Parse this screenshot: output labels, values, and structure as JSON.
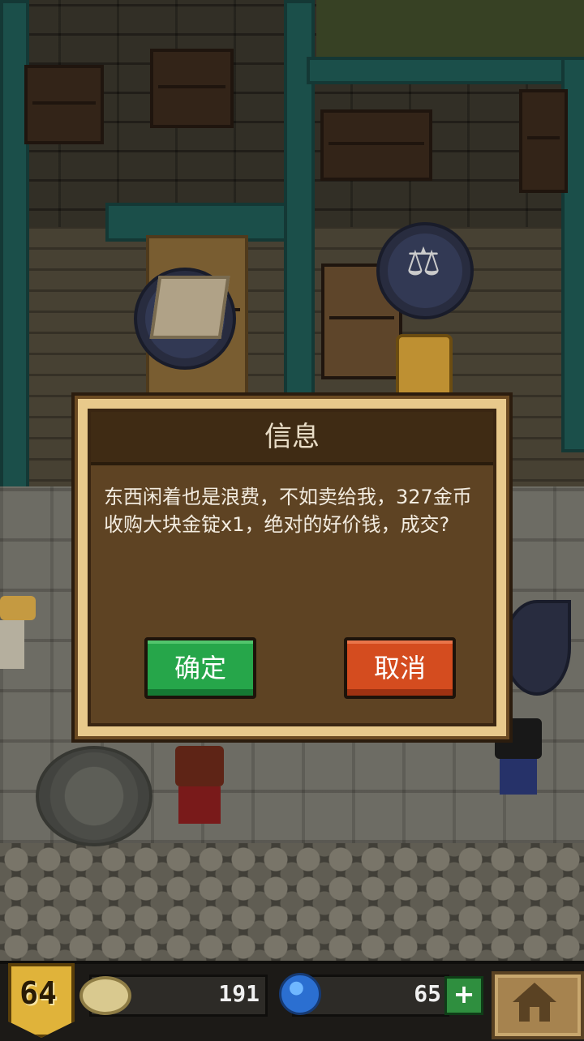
{
  "dialog": {
    "title": "信息",
    "message": "东西闲着也是浪费，不如卖给我，327金币收购大块金锭x1，绝对的好价钱，成交?",
    "confirm_label": "确定",
    "cancel_label": "取消"
  },
  "hud": {
    "level": "64",
    "gold": "191",
    "gems": "65",
    "add_gems_label": "+"
  },
  "icons": {
    "level": "shield-badge-icon",
    "gold": "gold-coin-icon",
    "gems": "blue-gem-icon",
    "home": "home-icon",
    "shop_bubble": "scale-icon",
    "item_bubble": "gold-ingot-icon"
  },
  "colors": {
    "confirm": "#26a64a",
    "cancel": "#d44c1f",
    "dialog_frame": "#e8c98b",
    "dialog_body": "#5e4323"
  }
}
